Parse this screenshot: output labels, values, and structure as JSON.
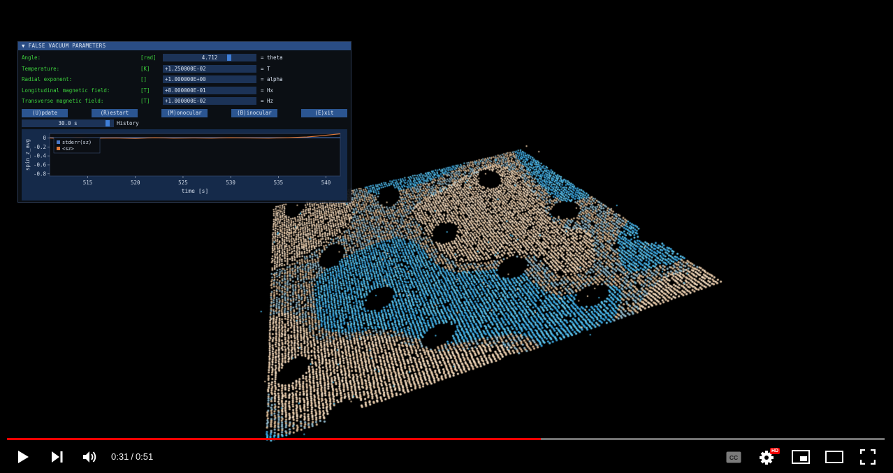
{
  "panel": {
    "title": "▼ FALSE VACUUM PARAMETERS",
    "params": [
      {
        "label": "Angle:",
        "unit": "[rad]",
        "value": "4.712",
        "name": "= theta",
        "slider": 0.72
      },
      {
        "label": "Temperature:",
        "unit": "[K]",
        "value": "+1.250000E-02",
        "name": "= T"
      },
      {
        "label": "Radial exponent:",
        "unit": "[]",
        "value": "+1.000000E+00",
        "name": "= alpha"
      },
      {
        "label": "Longitudinal magnetic field:",
        "unit": "[T]",
        "value": "+8.000000E-01",
        "name": "= Hx"
      },
      {
        "label": "Transverse magnetic field:",
        "unit": "[T]",
        "value": "+1.000000E-02",
        "name": "= Hz"
      }
    ],
    "buttons": [
      "(U)pdate",
      "(R)estart",
      "(M)onocular",
      "(B)inocular",
      "(E)xit"
    ],
    "history": {
      "value": "30.0 s",
      "label": "History",
      "slider": 0.95
    }
  },
  "chart_data": {
    "type": "line",
    "xlabel": "time [s]",
    "ylabel": "spin_z_avg",
    "xlim": [
      511,
      541.5
    ],
    "ylim": [
      -0.85,
      0.1
    ],
    "xticks": [
      515,
      520,
      525,
      530,
      535,
      540
    ],
    "yticks": [
      0,
      -0.2,
      -0.4,
      -0.6,
      -0.8
    ],
    "ytick_labels": [
      "0",
      "-0.2",
      "-0.4",
      "-0.6",
      "-0.8"
    ],
    "legend": "top-left",
    "series": [
      {
        "name": "stderr(sz)",
        "color": "#4a79c9",
        "x": [
          511,
          515,
          520,
          525,
          530,
          535,
          538,
          540,
          541.5
        ],
        "y": [
          0.005,
          0.005,
          0.005,
          0.005,
          0.005,
          0.005,
          0.006,
          0.006,
          0.006
        ]
      },
      {
        "name": "<sz>",
        "color": "#e07a3a",
        "x": [
          511,
          512,
          514,
          516,
          518,
          520,
          522,
          524,
          526,
          528,
          530,
          532,
          534,
          536,
          538,
          539,
          540,
          541.5
        ],
        "y": [
          0.0,
          -0.01,
          0.005,
          -0.005,
          0.0,
          -0.01,
          0.005,
          -0.005,
          0.0,
          -0.005,
          0.005,
          0.0,
          -0.005,
          0.005,
          0.02,
          0.04,
          0.06,
          0.09
        ]
      }
    ]
  },
  "video": {
    "current": "0:31",
    "duration": "0:51",
    "separator": "/",
    "progress": 0.608,
    "hd_badge": "HD",
    "icons": [
      "play-icon",
      "next-icon",
      "volume-icon",
      "captions-icon",
      "settings-icon",
      "miniplayer-icon",
      "theater-icon",
      "fullscreen-icon"
    ],
    "accent": "#ff0000"
  }
}
